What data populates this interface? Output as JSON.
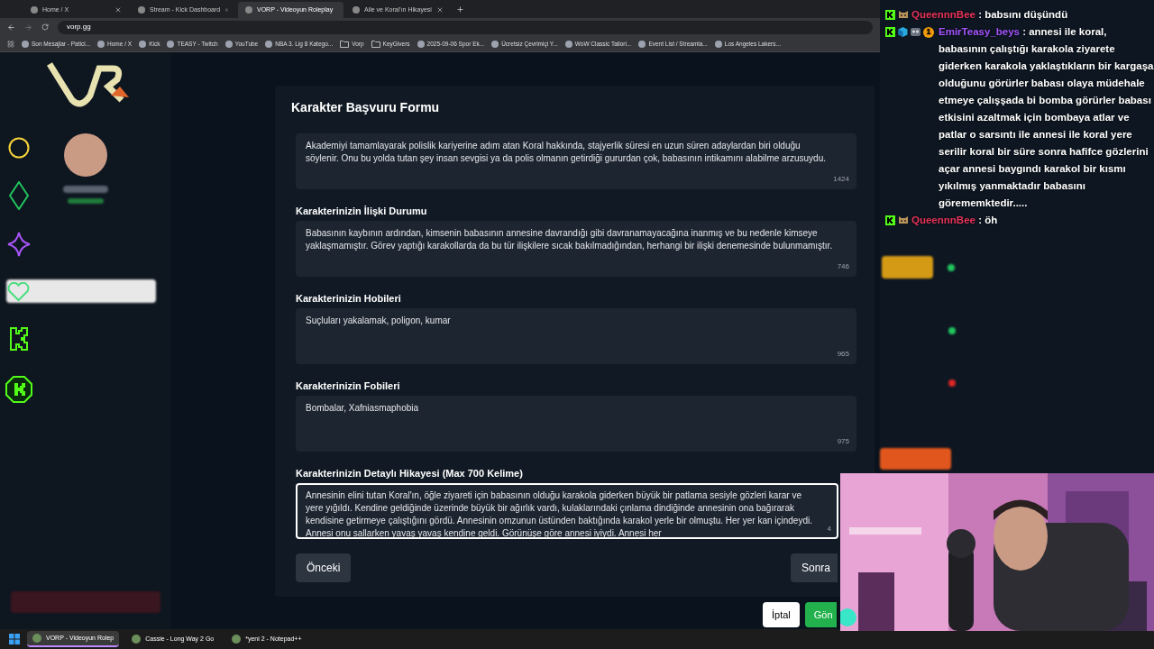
{
  "browser": {
    "tabs": [
      {
        "title": "Home / X",
        "selected": false
      },
      {
        "title": "Stream - Kick Dashboard",
        "selected": false
      },
      {
        "title": "VORP - Videoyun Roleplay",
        "selected": true
      },
      {
        "title": "Aile ve Koral'ın Hikayesi",
        "selected": false
      }
    ],
    "address": "vorp.gg",
    "bookmarks": [
      {
        "title": "Son Mesajlar - Patici...",
        "kind": "site"
      },
      {
        "title": "Home / X",
        "kind": "site"
      },
      {
        "title": "Kick",
        "kind": "site"
      },
      {
        "title": "TEASY - Twitch",
        "kind": "site"
      },
      {
        "title": "YouTube",
        "kind": "site"
      },
      {
        "title": "NBA 3. Lig 8 Katego...",
        "kind": "site"
      },
      {
        "title": "Vorp",
        "kind": "folder"
      },
      {
        "title": "KeyGivers",
        "kind": "folder"
      },
      {
        "title": "2025-09-06 Spor Ek...",
        "kind": "site"
      },
      {
        "title": "Ücretsiz Çevrimiçi Y...",
        "kind": "site"
      },
      {
        "title": "WoW Classic Tailori...",
        "kind": "site"
      },
      {
        "title": "Event List / Streamla...",
        "kind": "site"
      },
      {
        "title": "Los Angeles Lakers...",
        "kind": "site"
      }
    ]
  },
  "form": {
    "title": "Karakter Başvuru Formu",
    "fields": [
      {
        "value": "Akademiyi tamamlayarak polislik kariyerine adım atan Koral hakkında, stajyerlik süresi en uzun süren adaylardan biri olduğu söylenir. Onu bu yolda tutan şey insan sevgisi ya da polis olmanın getirdiği gururdan çok, babasının intikamını alabilme arzusuydu.",
        "counter": "1424",
        "focused": false
      },
      {
        "label": "Karakterinizin İlişki Durumu",
        "value": "Babasının kaybının ardından, kimsenin babasının annesine davrandığı gibi davranamayacağına inanmış ve bu nedenle kimseye yaklaşmamıştır. Görev yaptığı karakollarda da bu tür ilişkilere sıcak bakılmadığından, herhangi bir ilişki denemesinde bulunmamıştır.",
        "counter": "746",
        "focused": false
      },
      {
        "label": "Karakterinizin Hobileri",
        "value": "Suçluları yakalamak, poligon, kumar",
        "counter": "965",
        "focused": false
      },
      {
        "label": "Karakterinizin Fobileri",
        "value": "Bombalar, Xafniasmaphobia",
        "counter": "975",
        "focused": false
      },
      {
        "label": "Karakterinizin Detaylı Hikayesi (Max 700 Kelime)",
        "value": "Annesinin elini tutan Koral'ın, öğle ziyareti için babasının olduğu karakola giderken büyük bir patlama sesiyle gözleri karar ve yere yığıldı. Kendine geldiğinde üzerinde büyük bir ağırlık vardı, kulaklarındaki çınlama dindiğinde annesinin ona bağırarak kendisine getirmeye çalıştığını gördü. Annesinin omzunun üstünden baktığında karakol yerle bir olmuştu. Her yer kan içindeydi. Annesi onu sallarken yavaş yavaş kendine geldi. Görünüşe göre annesi iyiydi. Annesi her",
        "counter": "4",
        "focused": true
      }
    ],
    "previous": "Önceki",
    "next": "Sonra",
    "cancel": "İptal",
    "submit": "Gön"
  },
  "chat": [
    {
      "user": "QueennnBee",
      "color": "#e8335a",
      "badges": [
        {
          "kind": "kick"
        },
        {
          "kind": "bee"
        }
      ],
      "text": ": babsını düşündü"
    },
    {
      "user": "EmirTeasy_beys",
      "color": "#a455ff",
      "badges": [
        {
          "kind": "kick"
        },
        {
          "kind": "cube"
        },
        {
          "kind": "owl"
        },
        {
          "kind": "count",
          "text": "1"
        }
      ],
      "text": ": annesi ile koral, babasının çalıştığı karakola ziyarete giderken karakola yaklaştıkların bir kargaşa olduğunu görürler babası olaya müdehale etmeye çalışşada bi bomba görürler babası etkisini azaltmak için bombaya atlar ve patlar o sarsıntı ile annesi ile koral yere serilir koral bir süre sonra hafifce gözlerini açar annesi baygındı karakol bir kısmı yıkılmış yanmaktadır babasını görememktedir....."
    },
    {
      "user": "QueennnBee",
      "color": "#e8335a",
      "badges": [
        {
          "kind": "kick"
        },
        {
          "kind": "bee"
        }
      ],
      "text": ": öh"
    }
  ],
  "taskbar": [
    {
      "title": "VORP - Videoyun Rolep",
      "selected": true
    },
    {
      "title": "Cassie - Long Way 2 Go",
      "selected": false
    },
    {
      "title": "*yeni 2 - Notepad++",
      "selected": false
    }
  ]
}
